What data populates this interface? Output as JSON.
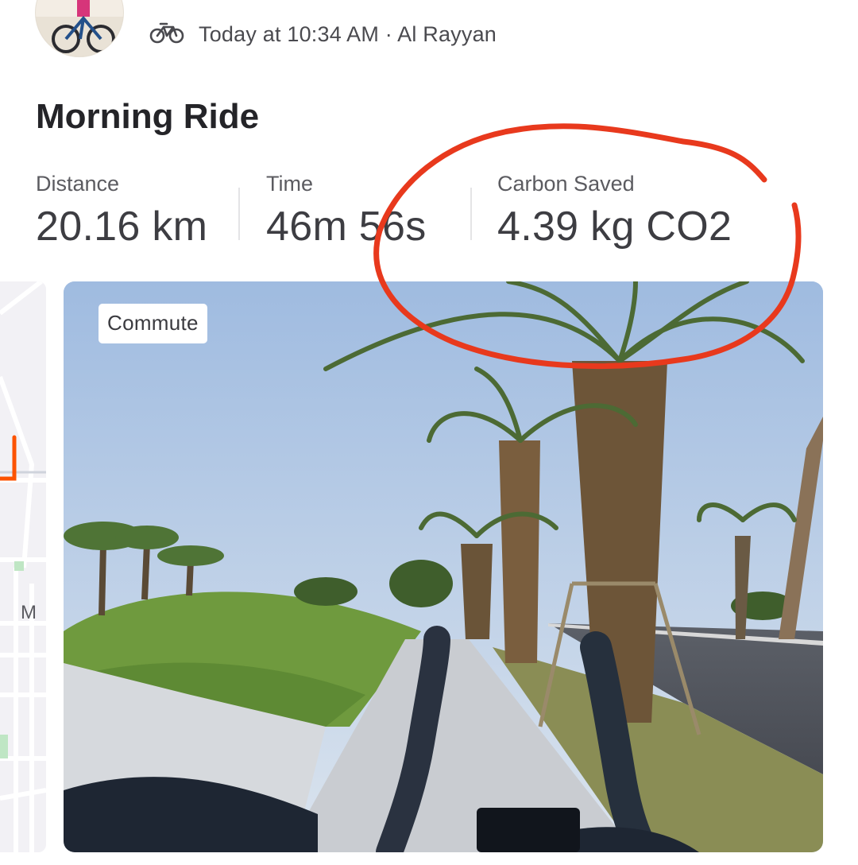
{
  "activity": {
    "meta": "Today at 10:34 AM · Al Rayyan",
    "title": "Morning Ride",
    "icon": "bike-icon"
  },
  "stats": [
    {
      "label": "Distance",
      "value": "20.16 km"
    },
    {
      "label": "Time",
      "value": "46m 56s"
    },
    {
      "label": "Carbon Saved",
      "value": "4.39 kg CO2"
    }
  ],
  "map": {
    "label": "M",
    "route_color": "#fc5200"
  },
  "photo": {
    "tag": "Commute"
  },
  "annotation": {
    "color": "#e8391d"
  }
}
